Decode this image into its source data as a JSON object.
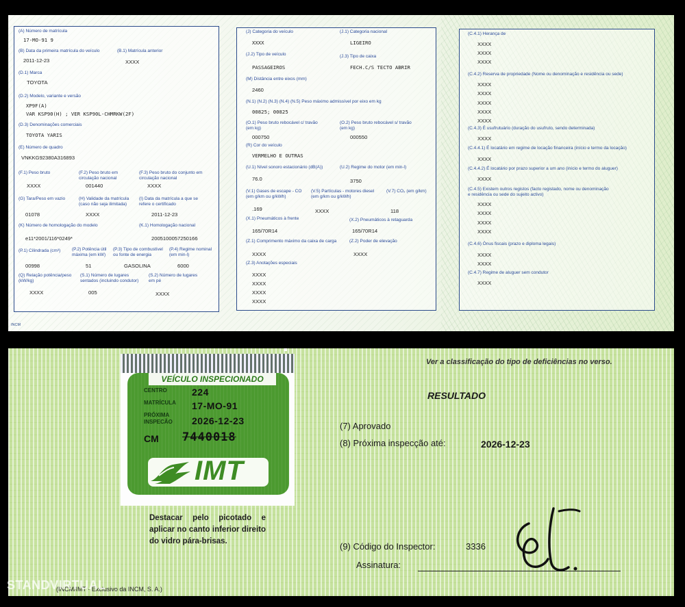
{
  "top": {
    "col1": {
      "a_label": "(A) Número de matrícula",
      "a_value": "17-MO-91 9",
      "b_label": "(B) Data da primeira matrícula do veículo",
      "b_value": "2011-12-23",
      "b1_label": "(B.1) Matrícula anterior",
      "b1_value": "XXXX",
      "d1_label": "(D.1) Marca",
      "d1_value": "TOYOTA",
      "d2_label": "(D.2) Modelo, variante e versão",
      "d2_value1": "XP9F(A)",
      "d2_value2": "VAR KSP90(H) ; VER KSP90L-CHMRKW(2F)",
      "d3_label": "(D.3) Denominações comerciais",
      "d3_value": "TOYOTA YARIS",
      "e_label": "(E) Número de quadro",
      "e_value": "VNKKG92380A316893",
      "f1_label": "(F.1) Peso bruto",
      "f1_value": "XXXX",
      "f2_label": "(F.2) Peso bruto em circulação nacional",
      "f2_value": "001440",
      "f3_label": "(F.3) Peso bruto do conjunto em circulação nacional",
      "f3_value": "XXXX",
      "g_label": "(G) Tara/Peso em vazio",
      "g_value": "01078",
      "h_label": "(H) Validade da matrícula (caso não seja ilimitada)",
      "h_value": "XXXX",
      "i_label": "(I) Data da matrícula a que se refere o certificado",
      "i_value": "2011-12-23",
      "k_label": "(K) Número de homologação do modelo",
      "k_value": "e11*2001/116*0249*",
      "k1_label": "(K.1) Homologação nacional",
      "k1_value": "2005100057250166",
      "p1_label": "(P.1) Cilindrada (cm³)",
      "p1_value": "00998",
      "p2_label": "(P.2) Potência útil máxima (em kW)",
      "p2_value": "51",
      "p3_label": "(P.3) Tipo de combustível ou fonte de energia",
      "p3_value": "GASOLINA",
      "p4_label": "(P.4) Regime nominal (em min-l)",
      "p4_value": "6000",
      "q_label": "(Q) Relação potência/peso (kW/kg)",
      "q_value": "XXXX",
      "s1_label": "(S.1) Número de lugares sentados (incluindo condutor)",
      "s1_value": "005",
      "s2_label": "(S.2) Número de lugares em pé",
      "s2_value": "XXXX",
      "incm": "INCM"
    },
    "col2": {
      "j_label": "(J) Categoria do veículo",
      "j_value": "XXXX",
      "j1_label": "(J.1) Categoria nacional",
      "j1_value": "LIGEIRO",
      "j2_label": "(J.2) Tipo de veículo",
      "j2_value": "PASSAGEIROS",
      "j3_label": "(J.3) Tipo de caixa",
      "j3_value": "FECH.C/S TECTO ABRIR",
      "m_label": "(M) Distância entre eixos (mm)",
      "m_value": "2460",
      "n_label": "(N.1) (N.2) (N.3) (N.4) (N.5) Peso máximo admissível por eixo em kg",
      "n_value": "00825; 00825",
      "o1_label": "(O.1) Peso bruto rebocável c/ travão (em kg)",
      "o1_value": "000750",
      "o2_label": "(O.2) Peso bruto rebocável s/ travão (em kg)",
      "o2_value": "000550",
      "r_label": "(R) Cor do veículo",
      "r_value": "VERMELHO E OUTRAS",
      "u1_label": "(U.1) Nível sonoro estacionário (dB(A))",
      "u1_value": "76.0",
      "u2_label": "(U.2) Regime do motor (em min-l)",
      "u2_value": "3750",
      "v1_label": "(V.1) Gases de escape - CO (em g/km ou g/kWh)",
      "v1_value": ".169",
      "v5_label": "(V.5) Partículas - motores diesel (em g/km ou g/kWh)",
      "v5_value": "XXXX",
      "v7_label": "(V.7) CO₂ (em g/km)",
      "v7_value": "118",
      "x1_label": "(X.1) Pneumáticos à frente",
      "x1_value": "165/70R14",
      "x2_label": "(X.2) Pneumáticos à retaguarda",
      "x2_value": "165/70R14",
      "z1_label": "(Z.1) Comprimento máximo da caixa de carga",
      "z1_value": "XXXX",
      "z2_label": "(Z.2) Poder de elevação",
      "z2_value": "XXXX",
      "z3_label": "(Z.3) Anotações especiais",
      "z3_values": [
        "XXXX",
        "XXXX",
        "XXXX",
        "XXXX"
      ]
    },
    "col3": {
      "c41_label": "(C.4.1) Herança de",
      "c41_values": [
        "XXXX",
        "XXXX",
        "XXXX"
      ],
      "c42_label": "(C.4.2) Reserva de propriedade (Nome ou denominação e residência ou sede)",
      "c42_values": [
        "XXXX",
        "XXXX",
        "XXXX",
        "XXXX",
        "XXXX"
      ],
      "c43_label": "(C.4.3) É usufrutuário (duração do usufruto, sendo determinada)",
      "c43_value": "XXXX",
      "c441_label": "(C.4.4.1) É locatário em regime de locação financeira (início e termo da locação)",
      "c441_value": "XXXX",
      "c442_label": "(C.4.4.2) É locatário por prazo superior a um ano (início e termo do aluguer)",
      "c442_value": "XXXX",
      "c45_label1": "(C.4.5) Existem outros registos (facto registado, nome ou denominação",
      "c45_label2": "e residência ou sede do sujeito activo)",
      "c45_values": [
        "XXXX",
        "XXXX",
        "XXXX",
        "XXXX"
      ],
      "c46_label": "(C.4.6) Ónus fiscais (prazo e diploma legais)",
      "c46_values": [
        "XXXX",
        "XXXX"
      ],
      "c47_label": "(C.4.7) Regime de aluguer sem condutor",
      "c47_value": "XXXX"
    }
  },
  "bottom": {
    "sticker": {
      "title": "VEÍCULO INSPECIONADO",
      "centro_label": "CENTRO",
      "centro_value": "224",
      "matricula_label": "MATRÍCULA",
      "matricula_value": "17-MO-91",
      "proxima_label1": "PRÓXIMA",
      "proxima_label2": "INSPECÃO",
      "proxima_value": "2026-12-23",
      "cm_label": "CM",
      "cm_value": "7440018",
      "logo_text": "IMT"
    },
    "instructions": "Destacar pelo picotado e aplicar no canto inferior direito do vidro pára-brisas.",
    "footer": "(INCM/IMT · Exclusivo da INCM, S. A.)",
    "note": "Ver a classificação do tipo de deficiências no verso.",
    "resultado": "RESULTADO",
    "item7": "(7) Aprovado",
    "item8_label": "(8) Próxima inspecção até:",
    "item8_value": "2026-12-23",
    "item9_label": "(9) Código do Inspector:",
    "item9_value": "3336",
    "assinatura": "Assinatura:"
  },
  "watermark": "STANDVIRTUAL",
  "colors": {
    "form_blue": "#2a4a9a",
    "green_paper": "#c6e29e",
    "sticker_green": "#4c9a30"
  }
}
